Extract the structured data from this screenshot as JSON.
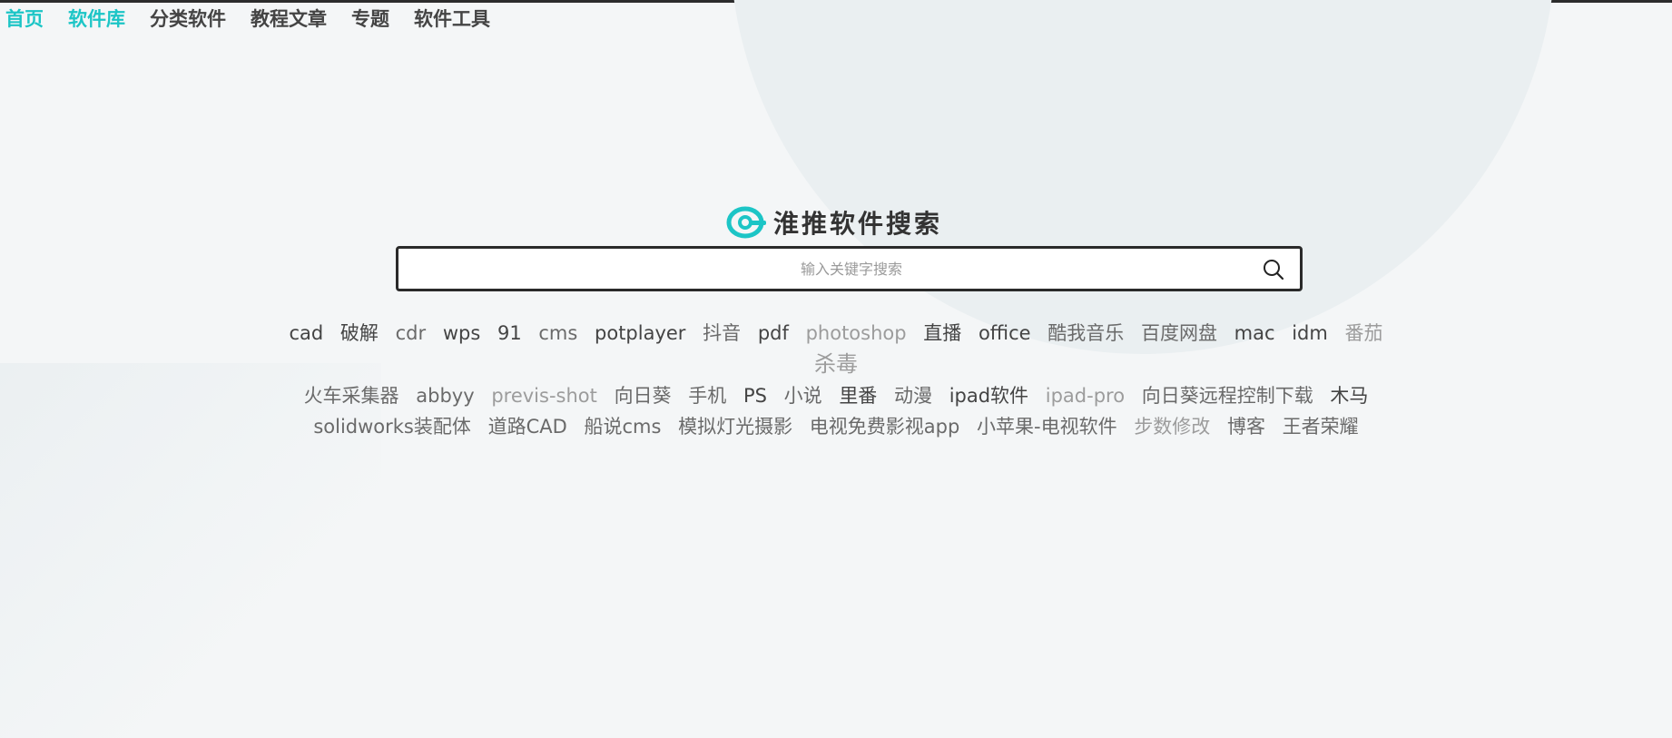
{
  "nav": [
    {
      "label": "首页",
      "active": true
    },
    {
      "label": "软件库",
      "active": true
    },
    {
      "label": "分类软件",
      "active": false
    },
    {
      "label": "教程文章",
      "active": false
    },
    {
      "label": "专题",
      "active": false
    },
    {
      "label": "软件工具",
      "active": false
    }
  ],
  "logo": {
    "text": "淮推软件搜索",
    "icon": "eye-logo-icon",
    "color": "#1cc5c6"
  },
  "search": {
    "placeholder": "输入关键字搜索",
    "value": "",
    "icon": "search-icon"
  },
  "tags": [
    "cad",
    "破解",
    "cdr",
    "wps",
    "91",
    "cms",
    "potplayer",
    "抖音",
    "pdf",
    "photoshop",
    "直播",
    "office",
    "酷我音乐",
    "百度网盘",
    "mac",
    "idm",
    "番茄",
    "杀毒",
    "火车采集器",
    "abbyy",
    "previs-shot",
    "向日葵",
    "手机",
    "PS",
    "小说",
    "里番",
    "动漫",
    "ipad软件",
    "ipad-pro",
    "向日葵远程控制下载",
    "木马",
    "solidworks装配体",
    "道路CAD",
    "船说cms",
    "模拟灯光摄影",
    "电视免费影视app",
    "小苹果-电视软件",
    "步数修改",
    "博客",
    "王者荣耀"
  ],
  "colors": {
    "accent": "#1cc5c6",
    "background": "#f4f6f7",
    "search_border": "#2a2a2a"
  }
}
